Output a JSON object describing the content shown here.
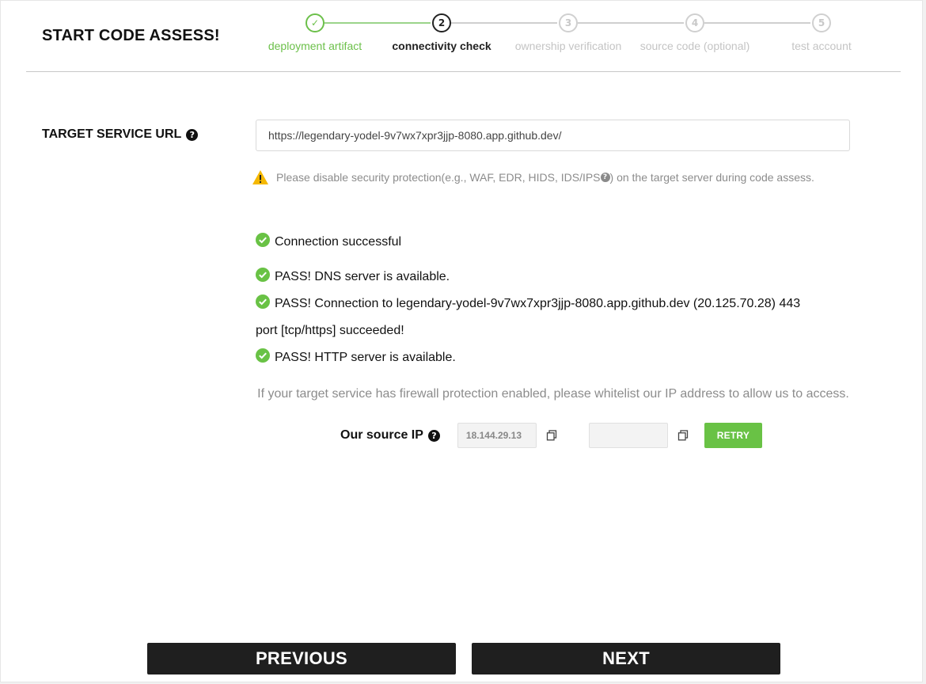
{
  "page": {
    "title": "START CODE ASSESS!"
  },
  "stepper": {
    "steps": [
      {
        "number": "✓",
        "label": "deployment artifact",
        "state": "done"
      },
      {
        "number": "2",
        "label": "connectivity check",
        "state": "active"
      },
      {
        "number": "3",
        "label": "ownership verification",
        "state": "pending"
      },
      {
        "number": "4",
        "label": "source code (optional)",
        "state": "pending"
      },
      {
        "number": "5",
        "label": "test account",
        "state": "pending"
      }
    ]
  },
  "target": {
    "label": "TARGET SERVICE URL",
    "url": "https://legendary-yodel-9v7wx7xpr3jjp-8080.app.github.dev/",
    "warning_before": "Please disable security protection(e.g., WAF, EDR, HIDS, IDS/IPS",
    "warning_after": " ) on the target server during code assess."
  },
  "checks": {
    "connection": "Connection successful",
    "dns": "PASS! DNS server is available.",
    "tcp_line1": "PASS! Connection to legendary-yodel-9v7wx7xpr3jjp-8080.app.github.dev (20.125.70.28) 443",
    "tcp_line2": "port [tcp/https] succeeded!",
    "http": "PASS! HTTP server is available."
  },
  "firewall": {
    "note": "If your target service has firewall protection enabled, please whitelist our IP address to allow us to access.",
    "ip_label": "Our source IP",
    "ip_primary": "18.144.29.13",
    "ip_secondary": "",
    "retry_label": "RETRY"
  },
  "nav": {
    "previous_label": "PREVIOUS",
    "next_label": "NEXT"
  },
  "colors": {
    "success": "#69c245",
    "dark": "#1f1f1f",
    "warning": "#f5b800"
  }
}
